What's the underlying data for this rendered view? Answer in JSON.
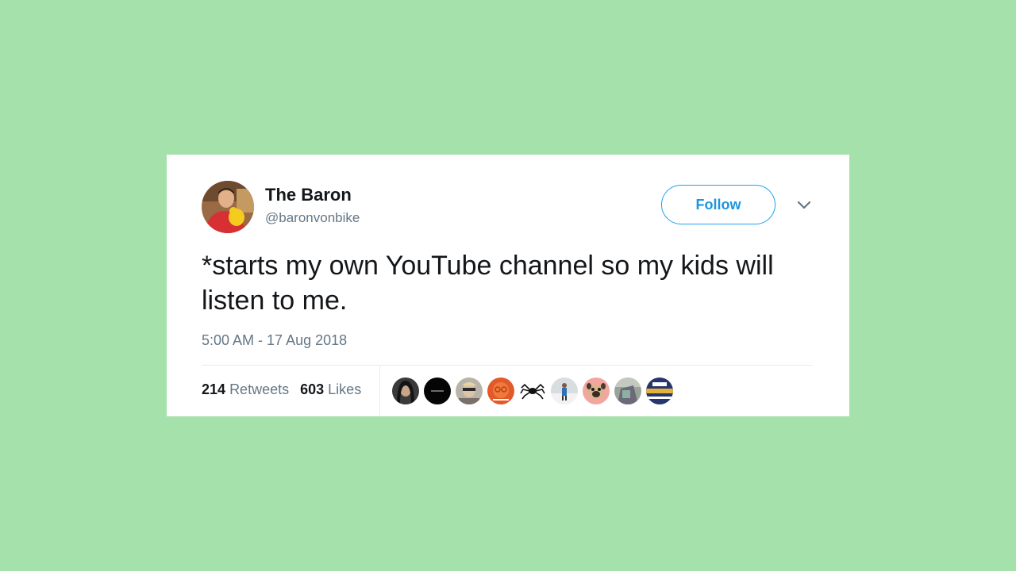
{
  "tweet": {
    "display_name": "The Baron",
    "handle": "@baronvonbike",
    "follow_label": "Follow",
    "text": "*starts my own YouTube channel so my kids will listen to me.",
    "timestamp": "5:00 AM - 17 Aug 2018",
    "retweets_count": "214",
    "retweets_label": "Retweets",
    "likes_count": "603",
    "likes_label": "Likes"
  },
  "icons": {
    "more_menu": "chevron-down-icon"
  },
  "colors": {
    "page_background": "#a5e1aa",
    "card_background": "#ffffff",
    "accent": "#1da1f2",
    "secondary_text": "#657786",
    "primary_text": "#14171a"
  }
}
